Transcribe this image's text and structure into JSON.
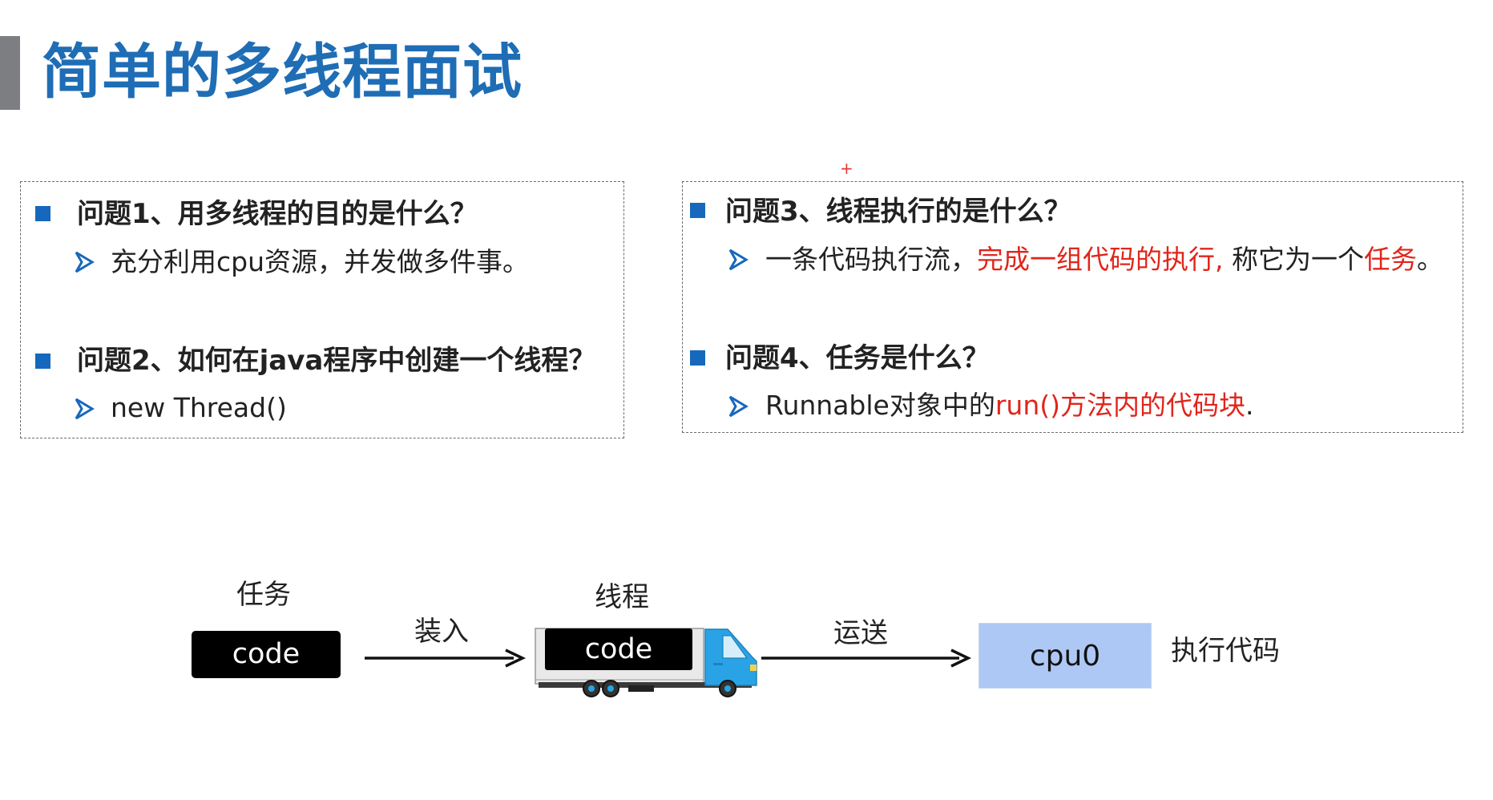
{
  "slide": {
    "title": "简单的多线程面试",
    "cursor_mark": "+"
  },
  "left_box": {
    "q1": "问题1、用多线程的目的是什么？",
    "a1": "充分利用cpu资源，并发做多件事。",
    "q2": "问题2、如何在java程序中创建一个线程？",
    "a2": "new Thread()"
  },
  "right_box": {
    "q3": "问题3、线程执行的是什么？",
    "a3_part1": "一条代码执行流，",
    "a3_part2_red": "完成一组代码的执行",
    "a3_part3": ",",
    "a3_part4": " 称它为一个",
    "a3_part5_red": "任务",
    "a3_part6": "。",
    "q4": "问题4、任务是什么？",
    "a4_part1": "Runnable对象中的",
    "a4_part2_red": "run()方法内的代码块",
    "a4_part3": "."
  },
  "diagram": {
    "task_label": "任务",
    "task_code": "code",
    "load_label": "装入",
    "thread_label": "线程",
    "truck_code": "code",
    "transport_label": "运送",
    "cpu_label": "cpu0",
    "execute_label": "执行代码"
  },
  "colors": {
    "title_blue": "#1f6db5",
    "bullet_blue": "#1668bd",
    "highlight_red": "#e0251b",
    "cpu_fill": "#aec8f5",
    "truck_cab": "#29a3e6"
  },
  "icons": {
    "bullet": "square-bullet-icon",
    "sub_bullet": "arrowhead-bullet-icon",
    "truck": "truck-icon"
  }
}
